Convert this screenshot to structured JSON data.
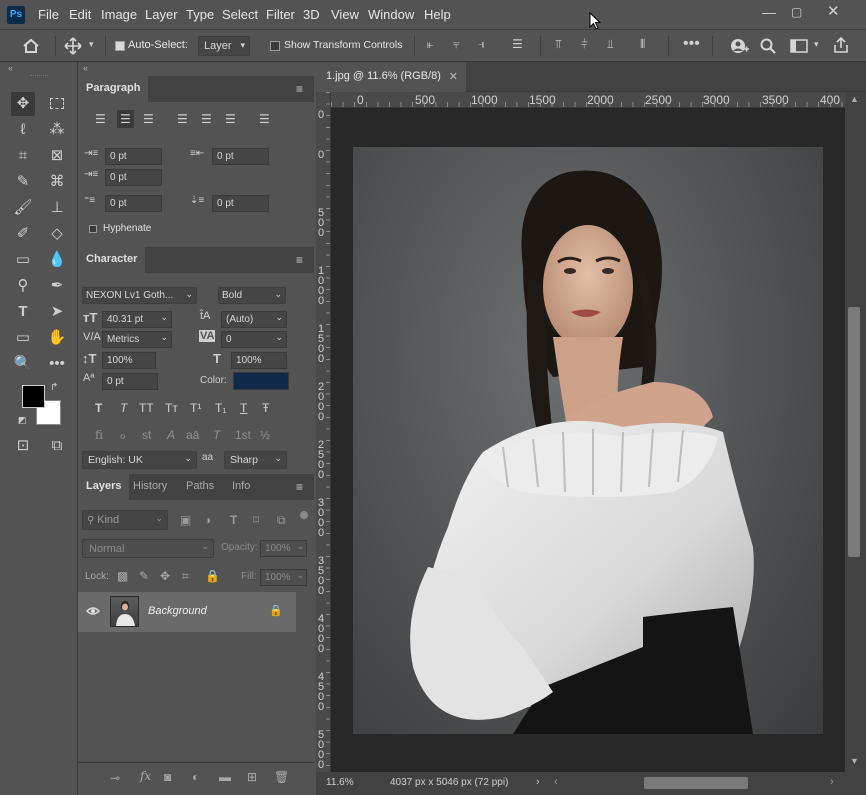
{
  "app": {
    "logo_text": "Ps"
  },
  "menu": [
    "File",
    "Edit",
    "Image",
    "Layer",
    "Type",
    "Select",
    "Filter",
    "3D",
    "View",
    "Window",
    "Help"
  ],
  "options_bar": {
    "auto_select_label": "Auto-Select:",
    "auto_select_checked": true,
    "auto_select_target": "Layer",
    "transform_controls_label": "Show Transform Controls",
    "transform_controls_checked": false
  },
  "paragraph_panel": {
    "title": "Paragraph",
    "indent_left": "0 pt",
    "indent_right": "0 pt",
    "indent_first": "0 pt",
    "space_before": "0 pt",
    "space_after": "0 pt",
    "hyphenate_label": "Hyphenate"
  },
  "character_panel": {
    "title": "Character",
    "font_family": "NEXON Lv1 Goth...",
    "font_style": "Bold",
    "font_size": "40.31 pt",
    "leading": "(Auto)",
    "kerning": "Metrics",
    "tracking": "0",
    "vertical_scale": "100%",
    "horizontal_scale": "100%",
    "baseline_shift": "0 pt",
    "color_label": "Color:",
    "color_value": "#0f2a4a",
    "language": "English: UK",
    "aa_icon": "aa",
    "antialias": "Sharp",
    "type_styles": [
      "T",
      "T",
      "TT",
      "Tт",
      "T¹",
      "T₁",
      "T",
      "Ŧ"
    ],
    "opentype": [
      "fi",
      "ℴ",
      "st",
      "A",
      "aā",
      "T",
      "1st",
      "½"
    ]
  },
  "layers_panel": {
    "tabs": [
      "Layers",
      "History",
      "Paths",
      "Info"
    ],
    "filter_kind": "Kind",
    "blend_mode": "Normal",
    "opacity_label": "Opacity:",
    "opacity_value": "100%",
    "lock_label": "Lock:",
    "fill_label": "Fill:",
    "fill_value": "100%",
    "layers": [
      {
        "name": "Background"
      }
    ]
  },
  "document": {
    "tab_title": "1.jpg @ 11.6% (RGB/8)",
    "ruler_h_ticks": [
      "0",
      "500",
      "1000",
      "1500",
      "2000",
      "2500",
      "3000",
      "3500",
      "400"
    ],
    "ruler_v_ticks": [
      "0",
      "0",
      "5 0 0",
      "1 0 0 0",
      "1 5 0 0",
      "2 0 0 0",
      "2 5 0 0",
      "3 0 0 0",
      "3 5 0 0",
      "4 0 0 0",
      "4 5 0 0",
      "5 0 0 0"
    ]
  },
  "status": {
    "zoom": "11.6%",
    "info": "4037 px x 5046 px (72 ppi)"
  },
  "colors": {
    "foreground": "#000000",
    "background": "#ffffff",
    "ui_bg": "#535353",
    "canvas_bg": "#282828"
  }
}
